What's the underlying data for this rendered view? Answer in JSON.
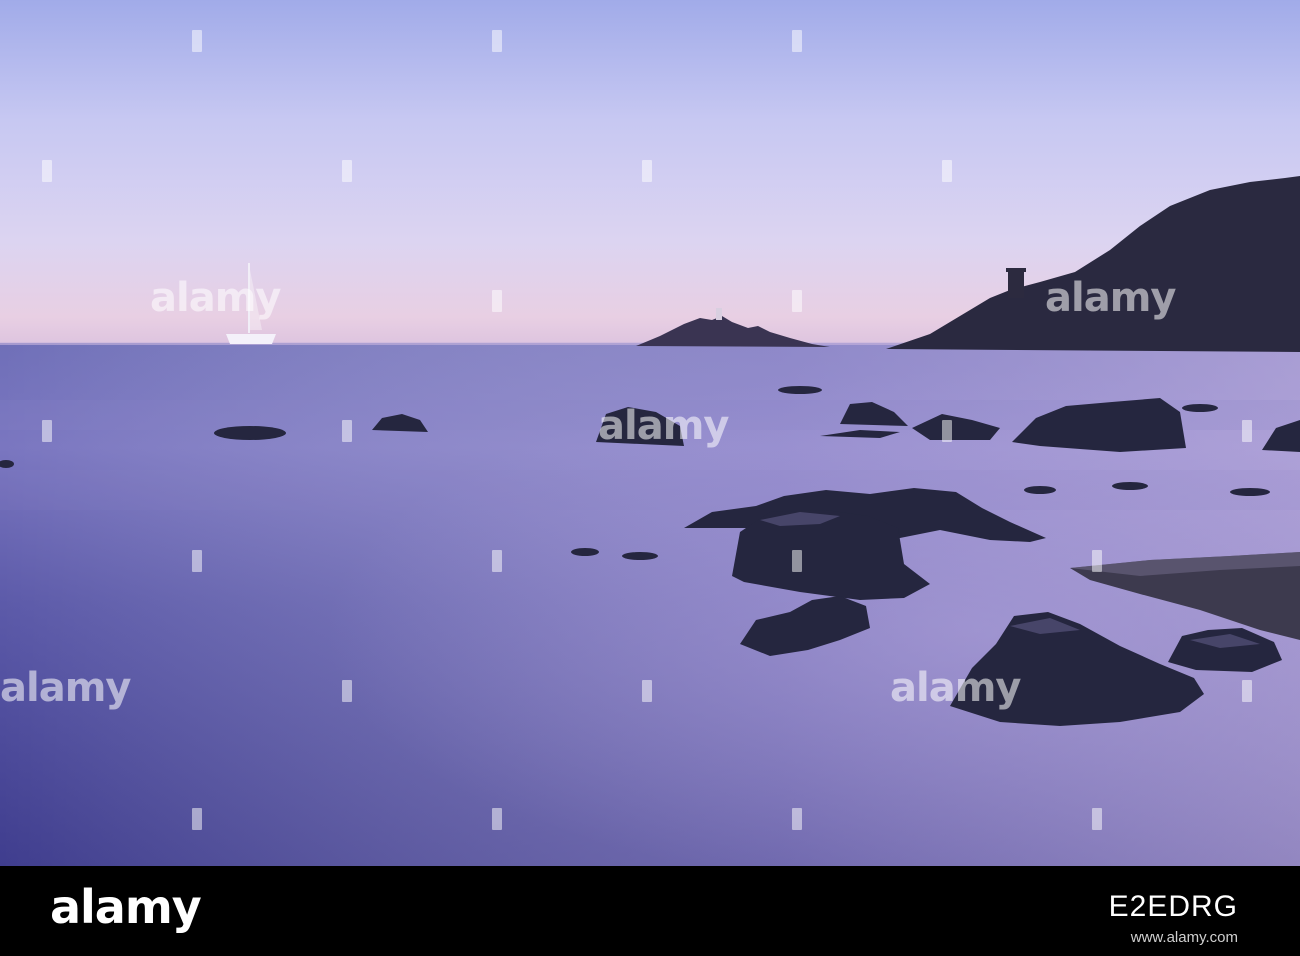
{
  "watermark": {
    "brand": "alamy"
  },
  "footer": {
    "logo": "alamy",
    "image_id": "E2EDRG",
    "url": "www.alamy.com"
  },
  "colors": {
    "sky_top": "#a7b0ec",
    "sky_mid": "#d8d3f2",
    "horizon_glow": "#e7c9df",
    "sea": "#5a5aa8",
    "sea_deep": "#3a3a86",
    "rock": "#262742",
    "footer_bg": "#000000"
  }
}
